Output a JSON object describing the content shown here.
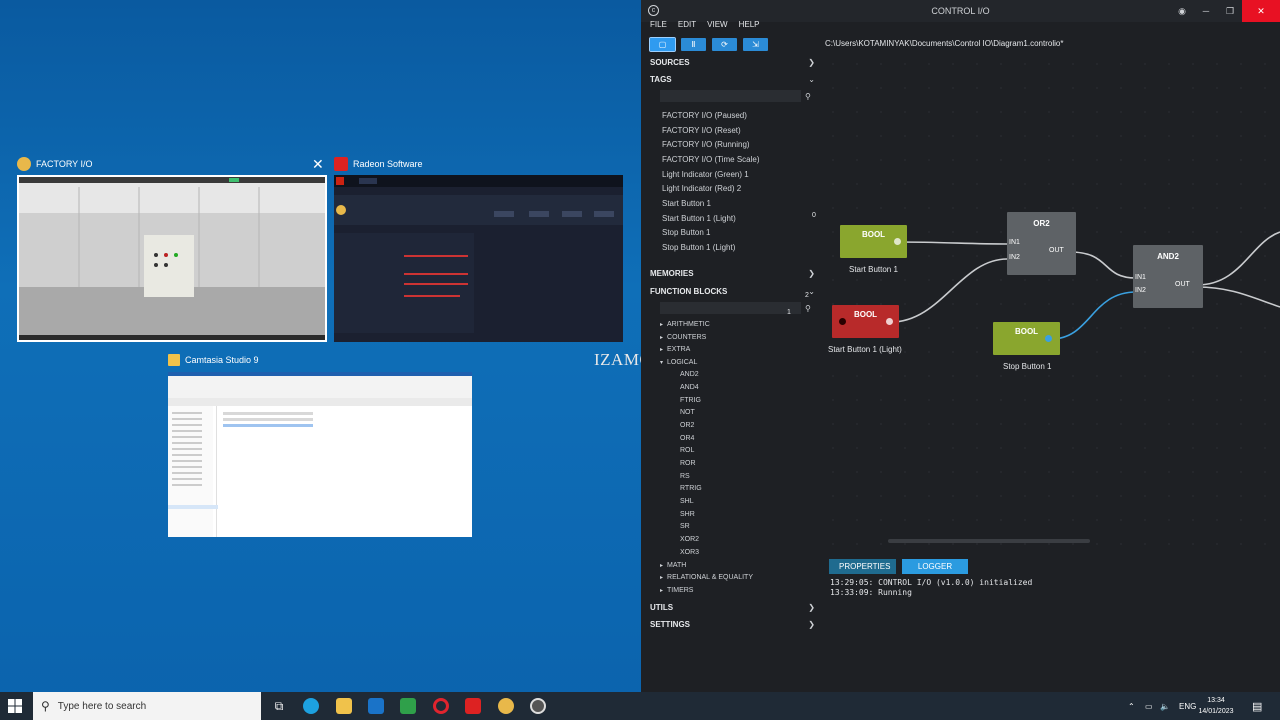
{
  "task_view": {
    "windows": [
      {
        "title": "FACTORY I/O"
      },
      {
        "title": "Radeon Software"
      },
      {
        "title": "Camtasia Studio 9"
      }
    ]
  },
  "watermark": "IZAMOTO",
  "control_io": {
    "title": "CONTROL I/O",
    "menu": [
      "FILE",
      "EDIT",
      "VIEW",
      "HELP"
    ],
    "file_path": "C:\\Users\\KOTAMINYAK\\Documents\\Control IO\\Diagram1.controlio*",
    "sections": {
      "sources": "SOURCES",
      "tags": "TAGS",
      "memories": "MEMORIES",
      "function_blocks": "FUNCTION BLOCKS",
      "utils": "UTILS",
      "settings": "SETTINGS"
    },
    "tags": [
      "FACTORY I/O (Paused)",
      "FACTORY I/O (Reset)",
      "FACTORY I/O (Running)",
      "FACTORY I/O (Time Scale)",
      "Light Indicator (Green) 1",
      "Light Indicator (Red) 2",
      "Start Button 1",
      "Start Button 1 (Light)",
      "Stop Button 1",
      "Stop Button 1 (Light)"
    ],
    "fb_categories": [
      "ARITHMETIC",
      "COUNTERS",
      "EXTRA",
      "LOGICAL",
      "MATH",
      "RELATIONAL & EQUALITY",
      "TIMERS"
    ],
    "logical_items": [
      "AND2",
      "AND4",
      "FTRIG",
      "NOT",
      "OR2",
      "OR4",
      "ROL",
      "ROR",
      "RS",
      "RTRIG",
      "SHL",
      "SHR",
      "SR",
      "XOR2",
      "XOR3"
    ],
    "nodes": {
      "bool1": {
        "label": "BOOL",
        "caption": "Start Button 1",
        "num": "0"
      },
      "bool2": {
        "label": "BOOL",
        "caption": "Start Button 1 (Light)",
        "num": "2"
      },
      "bool3": {
        "label": "BOOL",
        "caption": "Stop Button 1",
        "num": "1"
      },
      "or2": {
        "label": "OR2",
        "in1": "IN1",
        "in2": "IN2",
        "out": "OUT"
      },
      "and2": {
        "label": "AND2",
        "in1": "IN1",
        "in2": "IN2",
        "out": "OUT"
      }
    },
    "bottom_tabs": {
      "properties": "PROPERTIES",
      "logger": "LOGGER"
    },
    "log": [
      "13:29:05: CONTROL I/O (v1.0.0) initialized",
      "13:33:09: Running"
    ]
  },
  "taskbar": {
    "search_placeholder": "Type here to search",
    "language": "ENG",
    "time": "13:34",
    "date": "14/01/2023"
  },
  "colors": {
    "bool_green": "#8aa62e",
    "bool_red": "#b82a2a",
    "gate_gray": "#5e6266",
    "accent_blue": "#2b9be0",
    "desktop_blue": "#0f6fb8"
  }
}
